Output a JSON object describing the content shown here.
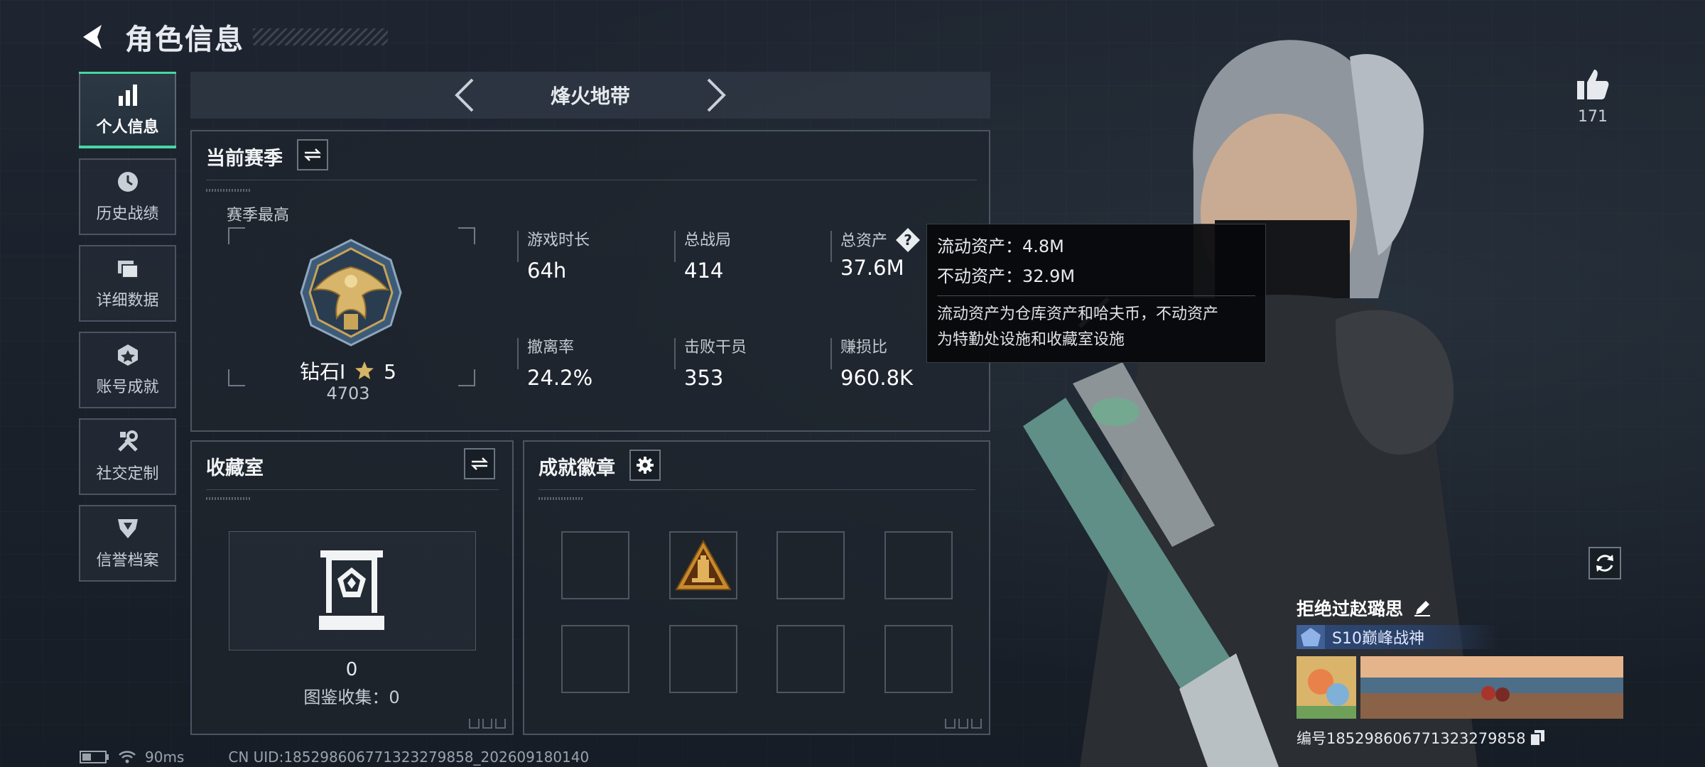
{
  "header": {
    "title": "角色信息"
  },
  "sidebar": {
    "items": [
      {
        "label": "个人信息",
        "icon": "bar-chart-icon",
        "active": true
      },
      {
        "label": "历史战绩",
        "icon": "clock-icon"
      },
      {
        "label": "详细数据",
        "icon": "folder-icon"
      },
      {
        "label": "账号成就",
        "icon": "achievement-icon"
      },
      {
        "label": "社交定制",
        "icon": "tools-icon"
      },
      {
        "label": "信誉档案",
        "icon": "shield-icon"
      }
    ]
  },
  "mode": {
    "name": "烽火地带"
  },
  "season": {
    "title": "当前赛季",
    "best_label": "赛季最高",
    "rank_name": "钻石Ⅰ",
    "rank_stars": "5",
    "rank_score": "4703",
    "stats": [
      {
        "label": "游戏时长",
        "value": "64h"
      },
      {
        "label": "总战局",
        "value": "414"
      },
      {
        "label": "总资产",
        "value": "37.6M"
      },
      {
        "label": "撤离率",
        "value": "24.2%"
      },
      {
        "label": "击败干员",
        "value": "353"
      },
      {
        "label": "赚损比",
        "value": "960.8K"
      }
    ]
  },
  "tooltip": {
    "liquid": "流动资产：4.8M",
    "fixed": "不动资产：32.9M",
    "desc_line1": "流动资产为仓库资产和哈夫币，不动资产",
    "desc_line2": "为特勤处设施和收藏室设施"
  },
  "collection": {
    "title": "收藏室",
    "count": "0",
    "label": "图鉴收集：0"
  },
  "badges": {
    "title": "成就徽章"
  },
  "likes": {
    "count": "171"
  },
  "player": {
    "name": "拒绝过赵璐思",
    "title": "S10巅峰战神",
    "id": "编号1852986067713232798​58"
  },
  "footer": {
    "ping": "90ms",
    "uid": "CN UID:1852986067713232798​58_202609180140"
  },
  "colors": {
    "accent": "#46d7a3",
    "panel_border": "#4b5561",
    "background": "#1e2530"
  }
}
